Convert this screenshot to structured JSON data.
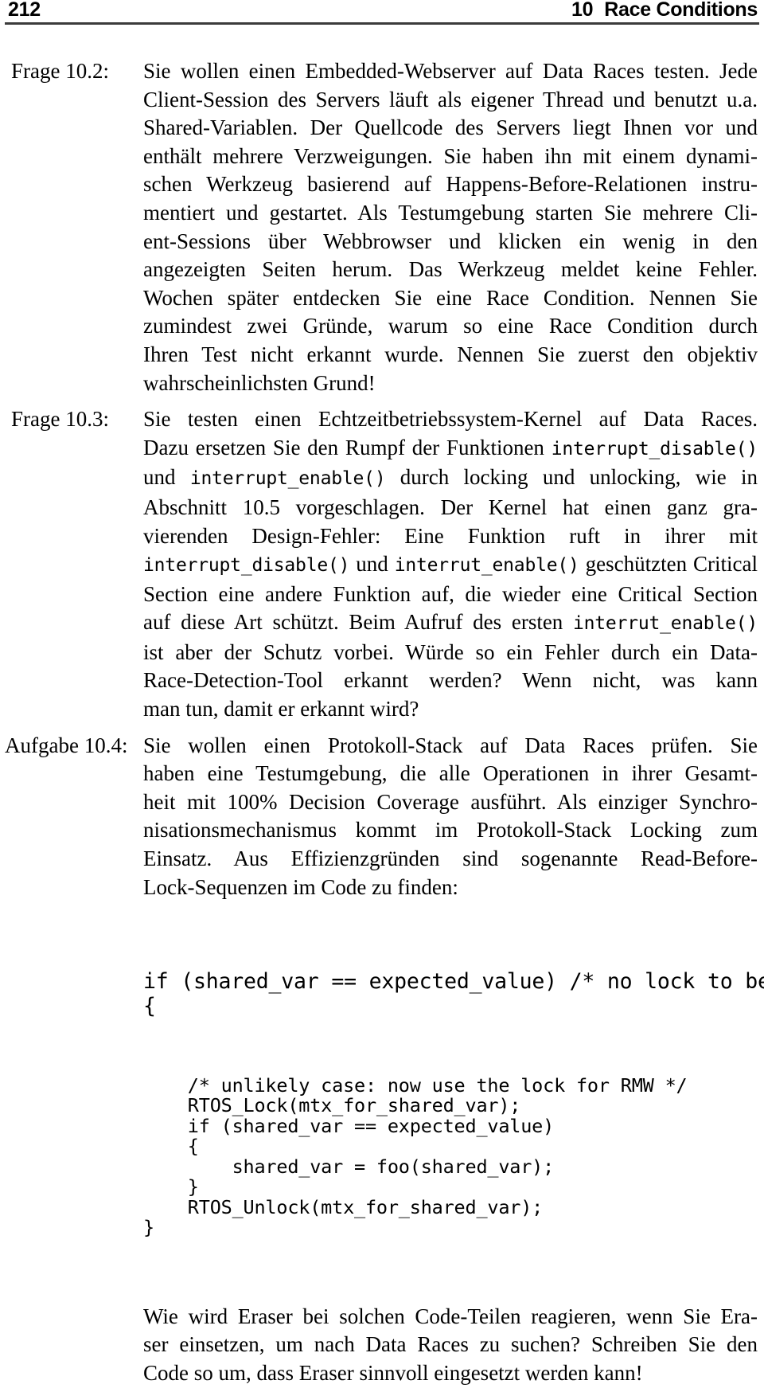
{
  "header": {
    "folio": "212",
    "chapter_number": "10",
    "chapter_title": "Race Conditions"
  },
  "questions": [
    {
      "label": "Frage 10.2:",
      "lines": [
        "Sie wollen einen Embedded-Webserver auf Data Races testen. Jede",
        "Client-Session des Servers läuft als eigener Thread und benutzt u.a.",
        "Shared-Variablen. Der Quellcode des Servers liegt Ihnen vor und",
        "enthält mehrere Verzweigungen. Sie haben ihn mit einem dynami-",
        "schen Werkzeug basierend auf Happens-Before-Relationen instru-",
        "mentiert und gestartet. Als Testumgebung starten Sie mehrere Cli-",
        "ent-Sessions über Webbrowser und klicken ein wenig in den",
        "angezeigten Seiten herum. Das Werkzeug meldet keine Fehler.",
        "Wochen später entdecken Sie eine Race Condition. Nennen Sie",
        "zumindest zwei Gründe, warum so eine Race Condition durch",
        "Ihren Test nicht erkannt wurde. Nennen Sie zuerst den objektiv",
        "wahrscheinlichsten Grund!"
      ]
    }
  ],
  "question2": {
    "label": "Frage 10.3:",
    "line1": "Sie testen einen Echtzeitbetriebssystem-Kernel auf Data Races.",
    "line2_a": "Dazu ersetzen Sie den Rumpf der Funktionen ",
    "line2_code": "interrupt_disable()",
    "line3_a": "und ",
    "line3_code": "interrupt_enable()",
    "line3_b": " durch locking und unlocking, wie in",
    "line4": "Abschnitt 10.5 vorgeschlagen. Der Kernel hat einen ganz gra-",
    "line5": "vierenden Design-Fehler: Eine Funktion ruft in ihrer mit",
    "line6_code_a": "interrupt_disable()",
    "line6_mid": " und ",
    "line6_code_b": "interrut_enable()",
    "line6_tail": " geschützten Critical",
    "line7": "Section eine andere Funktion auf, die wieder eine Critical Section",
    "line8_a": "auf diese Art schützt. Beim Aufruf des ersten ",
    "line8_code": "interrut_enable()",
    "line9": "ist aber der Schutz vorbei. Würde so ein Fehler durch ein Data-",
    "line10": "Race-Detection-Tool erkannt werden? Wenn nicht, was kann",
    "line11": "man tun, damit er erkannt wird?"
  },
  "question3": {
    "label": "Aufgabe 10.4:",
    "intro_lines": [
      "Sie wollen einen Protokoll-Stack auf Data Races prüfen. Sie",
      "haben eine Testumgebung, die alle Operationen in ihrer Gesamt-",
      "heit mit 100% Decision Coverage ausführt. Als einziger Synchro-",
      "nisationsmechanismus kommt im Protokoll-Stack Locking zum",
      "Einsatz. Aus Effizienzgründen sind sogenannte Read-Before-",
      "Lock-Sequenzen im Code zu finden:"
    ],
    "code_lead": "if (shared_var == expected_value) /* no lock to be fast */\n{",
    "code_rest": "    /* unlikely case: now use the lock for RMW */\n    RTOS_Lock(mtx_for_shared_var);\n    if (shared_var == expected_value)\n    {\n        shared_var = foo(shared_var);\n    }\n    RTOS_Unlock(mtx_for_shared_var);\n}",
    "outro_lines": [
      "Wie wird Eraser bei solchen Code-Teilen reagieren, wenn Sie Era-",
      "ser einsetzen, um nach Data Races zu suchen? Schreiben Sie den",
      "Code so um, dass Eraser sinnvoll eingesetzt werden kann!"
    ]
  }
}
